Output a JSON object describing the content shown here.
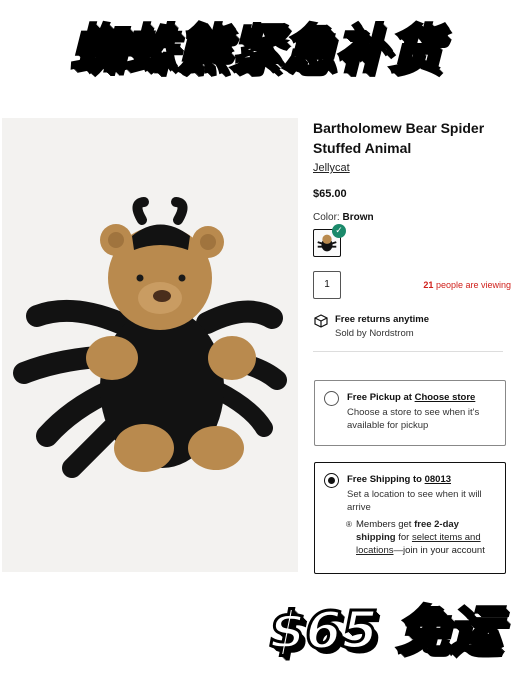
{
  "headline": "蜘蛛熊紧急补货",
  "promo": "$65 免运",
  "product": {
    "title": "Bartholomew Bear Spider Stuffed Animal",
    "brand": "Jellycat",
    "price": "$65.00",
    "color_label": "Color:",
    "color_value": "Brown",
    "quantity": "1",
    "viewing_count": "21",
    "viewing_text": "people are viewing"
  },
  "returns": {
    "title": "Free returns anytime",
    "sold_by": "Sold by Nordstrom",
    "icon": "box-return-icon"
  },
  "pickup": {
    "title_prefix": "Free Pickup at",
    "title_link": "Choose store",
    "description": "Choose a store to see when it's available for pickup",
    "selected": false
  },
  "shipping": {
    "title_prefix": "Free Shipping to",
    "zip": "08013",
    "description": "Set a location to see when it will arrive",
    "member_prefix": "Members get",
    "member_bold": "free 2-day shipping",
    "member_mid": "for",
    "member_link": "select items and locations",
    "member_suffix": "—join in your account",
    "selected": true
  },
  "colors": {
    "check_green": "#1b8a6b",
    "viewing_red": "#d0211c",
    "bear_tan": "#b98a4e",
    "spider_black": "#121212"
  }
}
